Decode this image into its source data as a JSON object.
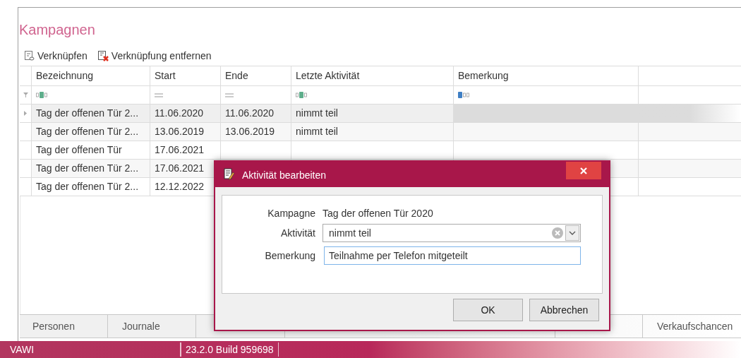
{
  "title": "Kampagnen",
  "toolbar": [
    {
      "label": "Verknüpfen",
      "kind": "link"
    },
    {
      "label": "Verknüpfung entfernen",
      "kind": "unlink"
    }
  ],
  "table": {
    "columns": [
      {
        "label": "Bezeichnung",
        "kind": "contains"
      },
      {
        "label": "Start",
        "kind": "equals"
      },
      {
        "label": "Ende",
        "kind": "equals"
      },
      {
        "label": "Letzte Aktivität",
        "kind": "contains"
      },
      {
        "label": "Bemerkung",
        "kind": "starts"
      }
    ],
    "rows": [
      {
        "selected": true,
        "cells": [
          "Tag der offenen Tür 2...",
          "11.06.2020",
          "11.06.2020",
          "nimmt teil"
        ]
      },
      {
        "selected": false,
        "cells": [
          "Tag der offenen Tür 2...",
          "13.06.2019",
          "13.06.2019",
          "nimmt teil"
        ]
      },
      {
        "selected": false,
        "cells": [
          "Tag der offenen Tür",
          "17.06.2021"
        ]
      },
      {
        "selected": false,
        "cells": [
          "Tag der offenen Tür 2...",
          "17.06.2021"
        ]
      },
      {
        "selected": false,
        "cells": [
          "Tag der offenen Tür 2...",
          "12.12.2022"
        ]
      }
    ]
  },
  "tabs": [
    "Personen",
    "Journale",
    "Verkaufschancen"
  ],
  "status_bar": [
    "VAWI",
    "23.2.0 Build 959698"
  ],
  "dialog": {
    "title": "Aktivität bearbeiten",
    "fields": [
      {
        "kind": "text",
        "label": "Kampagne",
        "value": "Tag der offenen Tür 2020"
      },
      {
        "kind": "combo",
        "label": "Aktivität",
        "value": "nimmt teil"
      },
      {
        "kind": "input",
        "label": "Bemerkung",
        "value": "Teilnahme per Telefon mitgeteilt",
        "focused": true
      }
    ],
    "buttons": [
      "OK",
      "Abbrechen"
    ]
  }
}
